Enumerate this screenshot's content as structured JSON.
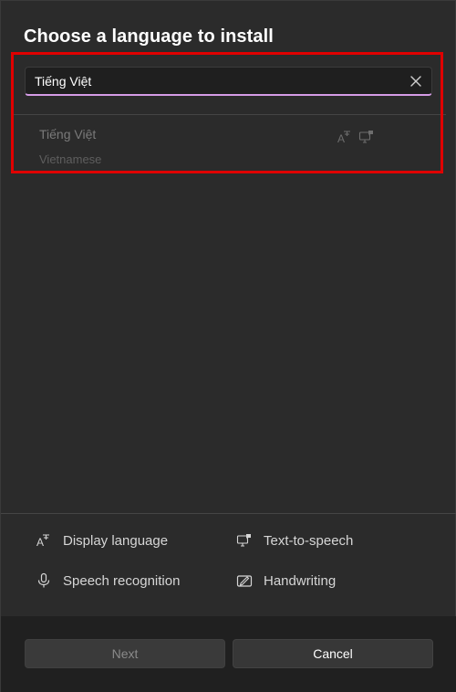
{
  "dialog": {
    "title": "Choose a language to install"
  },
  "search": {
    "value": "Tiếng Việt",
    "clear_icon": "close-icon"
  },
  "results": [
    {
      "name": "Tiếng Việt",
      "subtitle": "Vietnamese",
      "icons": [
        "display-language-icon",
        "text-to-speech-icon"
      ]
    }
  ],
  "features": {
    "display_language": "Display language",
    "text_to_speech": "Text-to-speech",
    "speech_recognition": "Speech recognition",
    "handwriting": "Handwriting"
  },
  "footer": {
    "next_label": "Next",
    "cancel_label": "Cancel"
  },
  "colors": {
    "accent_underline": "#d59ce6",
    "highlight_box": "#e00000"
  }
}
